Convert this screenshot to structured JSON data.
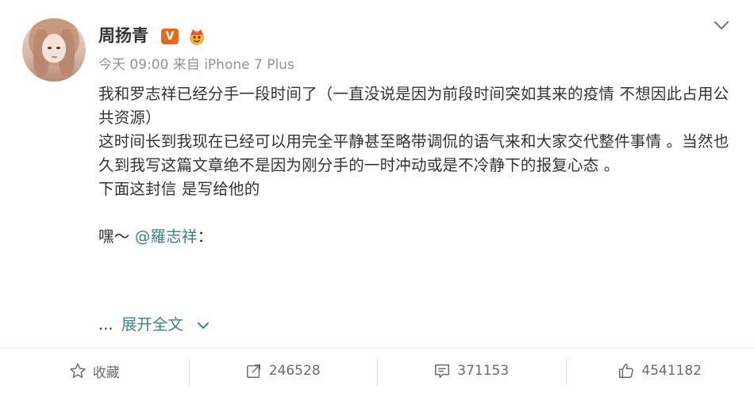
{
  "post": {
    "username": "周扬青",
    "verified_badge": "V",
    "meta": "今天 09:00 来自 iPhone 7 Plus",
    "paragraphs": [
      "我和罗志祥已经分手一段时间了（一直没说是因为前段时间突如其来的疫情 不想因此占用公共资源）",
      "这时间长到我现在已经可以用完全平静甚至略带调侃的语气来和大家交代整件事情 。当然也久到我写这篇文章绝不是因为刚分手的一时冲动或是不冷静下的报复心态 。",
      "下面这封信 是写给他的"
    ],
    "greeting_prefix": "嘿～ ",
    "mention": "@羅志祥",
    "greeting_suffix": "：",
    "ellipsis": "...",
    "expand_label": "展开全文",
    "icons": {
      "menu": "chevron-down-icon",
      "crown": "crown-icon",
      "expand": "chevron-down-icon"
    }
  },
  "actions": {
    "favorite": {
      "label": "收藏",
      "icon": "star-icon"
    },
    "repost": {
      "label": "246528",
      "icon": "repost-icon"
    },
    "comment": {
      "label": "371153",
      "icon": "comment-icon"
    },
    "like": {
      "label": "4541182",
      "icon": "thumbs-up-icon"
    }
  },
  "colors": {
    "link": "#3d7f87",
    "badge": "#e66a1d",
    "meta_text": "#939393"
  }
}
